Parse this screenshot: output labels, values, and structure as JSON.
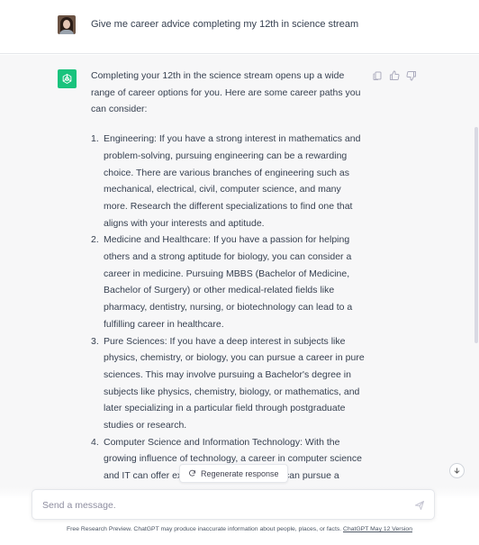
{
  "user": {
    "avatar_icon": "user-avatar-photo",
    "message": "Give me career advice completing my 12th in science stream"
  },
  "assistant": {
    "logo_icon": "openai-logo-icon",
    "intro": "Completing your 12th in the science stream opens up a wide range of career options for you. Here are some career paths you can consider:",
    "items": [
      {
        "number": "1.",
        "text": "Engineering: If you have a strong interest in mathematics and problem-solving, pursuing engineering can be a rewarding choice. There are various branches of engineering such as mechanical, electrical, civil, computer science, and many more. Research the different specializations to find one that aligns with your interests and aptitude."
      },
      {
        "number": "2.",
        "text": "Medicine and Healthcare: If you have a passion for helping others and a strong aptitude for biology, you can consider a career in medicine. Pursuing MBBS (Bachelor of Medicine, Bachelor of Surgery) or other medical-related fields like pharmacy, dentistry, nursing, or biotechnology can lead to a fulfilling career in healthcare."
      },
      {
        "number": "3.",
        "text": "Pure Sciences: If you have a deep interest in subjects like physics, chemistry, or biology, you can pursue a career in pure sciences. This may involve pursuing a Bachelor's degree in subjects like physics, chemistry, biology, or mathematics, and later specializing in a particular field through postgraduate studies or research."
      },
      {
        "number": "4.",
        "text": "Computer Science and Information Technology: With the growing influence of technology, a career in computer science and IT can offer exciting opportunities. You can pursue a degree in computer science, software engineering, or related fields."
      }
    ],
    "actions": [
      "copy-icon",
      "thumbs-up-icon",
      "thumbs-down-icon"
    ]
  },
  "regenerate": {
    "label": "Regenerate response",
    "icon": "refresh-icon"
  },
  "composer": {
    "placeholder": "Send a message.",
    "send_icon": "send-icon"
  },
  "footer": {
    "text": "Free Research Preview. ChatGPT may produce inaccurate information about people, places, or facts. ",
    "link": "ChatGPT May 12 Version"
  },
  "colors": {
    "brand": "#19c37d",
    "assistant_bg": "#f7f7f8",
    "text": "#374151"
  }
}
